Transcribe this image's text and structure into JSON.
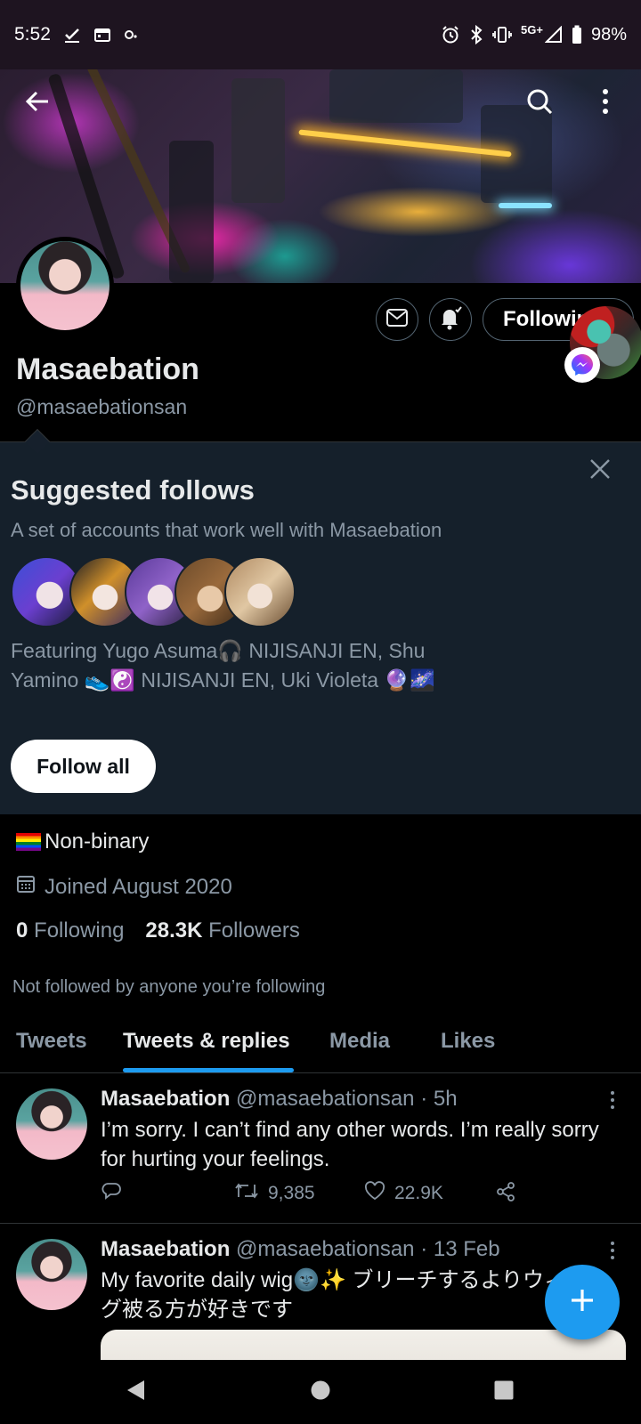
{
  "status_bar": {
    "time": "5:52",
    "network": "5G+",
    "battery": "98%"
  },
  "profile": {
    "display_name": "Masaebation",
    "handle": "@masaebationsan",
    "following_button_label": "Following",
    "bio": "Non-binary",
    "joined": "Joined August 2020",
    "following_count": "0",
    "following_label": "Following",
    "followers_count": "28.3K",
    "followers_label": "Followers",
    "not_followed_note": "Not followed by anyone you’re following"
  },
  "suggested_follows": {
    "title": "Suggested follows",
    "subtitle": "A set of accounts that work well with Masaebation",
    "featuring_line1": "Featuring Yugo Asuma🎧 NIJISANJI EN, Shu",
    "featuring_line2": "Yamino 👟☯️ NIJISANJI EN, Uki Violeta 🔮🌌",
    "follow_all_label": "Follow all"
  },
  "tabs": [
    {
      "label": "Tweets"
    },
    {
      "label": "Tweets & replies"
    },
    {
      "label": "Media"
    },
    {
      "label": "Likes"
    }
  ],
  "active_tab": "Tweets & replies",
  "tweets": [
    {
      "name": "Masaebation",
      "meta": "@masaebationsan · 5h",
      "text": "I’m sorry. I can’t find any other words. I’m really sorry for hurting your feelings.",
      "retweets": "9,385",
      "likes": "22.9K"
    },
    {
      "name": "Masaebation",
      "meta": "@masaebationsan · 13 Feb",
      "text": "My favorite daily wig🌚✨ ブリーチするよりウィッグ被る方が好きです"
    }
  ],
  "colors": {
    "accent": "#1d9bf0",
    "background": "#000000",
    "suggest_background": "#15202b",
    "muted_text": "#8b98a5"
  },
  "icons": [
    "back-arrow-icon",
    "search-icon",
    "more-vertical-icon",
    "mail-icon",
    "bell-icon",
    "close-icon",
    "calendar-icon",
    "reply-icon",
    "retweet-icon",
    "like-icon",
    "share-icon",
    "plus-icon",
    "messenger-icon"
  ]
}
